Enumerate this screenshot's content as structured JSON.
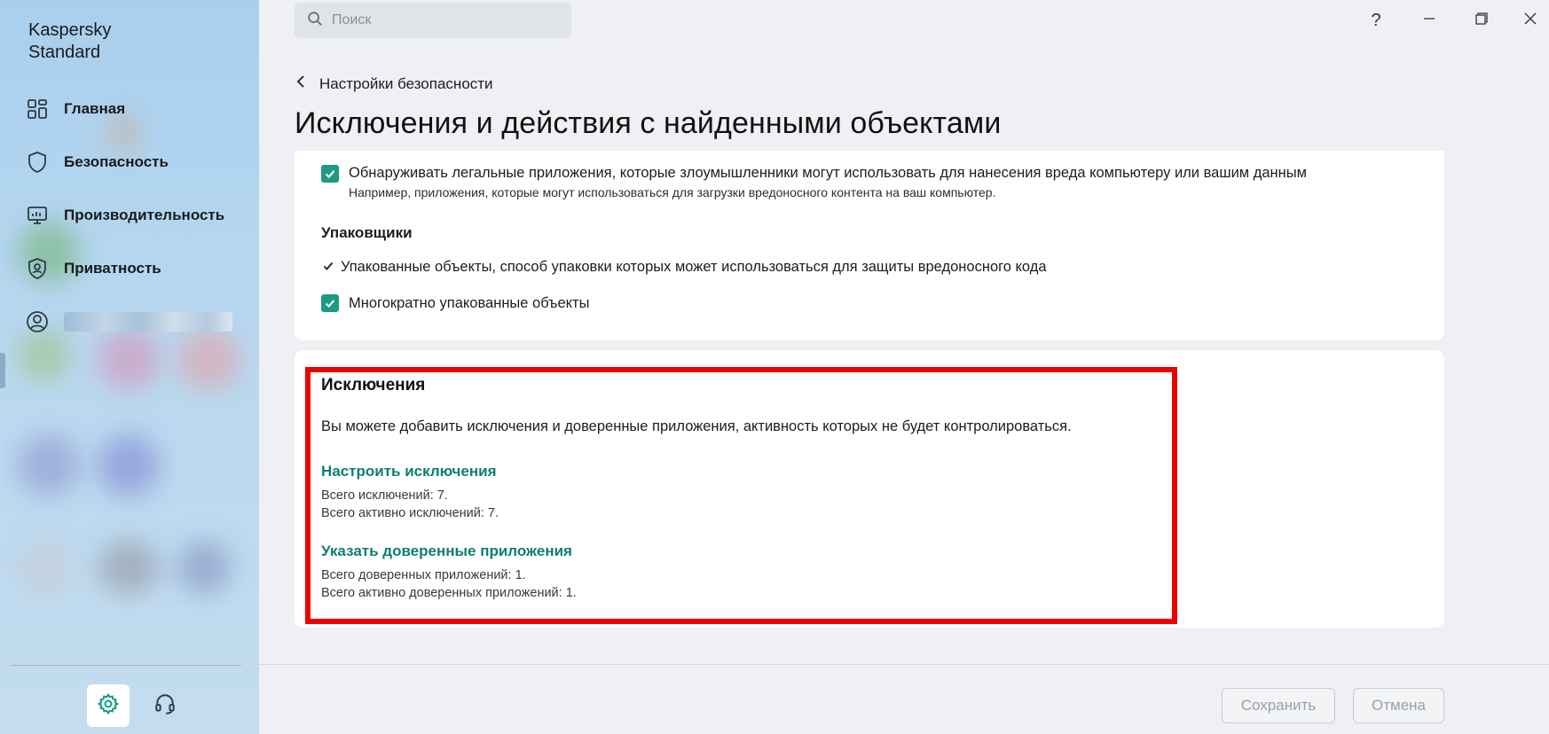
{
  "app": {
    "title_line1": "Kaspersky",
    "title_line2": "Standard"
  },
  "sidebar": {
    "items": [
      {
        "label": "Главная",
        "icon": "grid-icon"
      },
      {
        "label": "Безопасность",
        "icon": "shield-icon"
      },
      {
        "label": "Производительность",
        "icon": "monitor-icon"
      },
      {
        "label": "Приватность",
        "icon": "privacy-shield-icon"
      }
    ],
    "account_icon": "user-circle-icon",
    "bottom": {
      "settings_icon": "gear-icon",
      "support_icon": "headset-icon"
    }
  },
  "header": {
    "search_placeholder": "Поиск",
    "window_controls": [
      "help-icon",
      "minimize-icon",
      "restore-icon",
      "close-icon"
    ]
  },
  "breadcrumb": {
    "label": "Настройки безопасности"
  },
  "page": {
    "title": "Исключения и действия с найденными объектами"
  },
  "detect_section": {
    "legal_apps_label": "Обнаруживать легальные приложения, которые злоумышленники могут использовать для нанесения вреда компьютеру или вашим данным",
    "legal_apps_note": "Например, приложения, которые могут использоваться для загрузки вредоносного контента на ваш компьютер.",
    "packers_heading": "Упаковщики",
    "packed_objects_label": "Упакованные объекты, способ упаковки которых может использоваться для защиты вредоносного кода",
    "multi_packed_label": "Многократно упакованные объекты"
  },
  "exclusions": {
    "title": "Исключения",
    "description": "Вы можете добавить исключения и доверенные приложения, активность которых не будет контролироваться.",
    "configure_link": "Настроить исключения",
    "total_exclusions": "Всего исключений: 7.",
    "active_exclusions": "Всего активно исключений: 7.",
    "trusted_link": "Указать доверенные приложения",
    "total_trusted": "Всего доверенных приложений: 1.",
    "active_trusted": "Всего активно доверенных приложений: 1."
  },
  "footer": {
    "save_label": "Сохранить",
    "cancel_label": "Отмена"
  },
  "colors": {
    "accent": "#1e9a84",
    "link": "#0f7f6c",
    "highlight": "#ee0000"
  }
}
